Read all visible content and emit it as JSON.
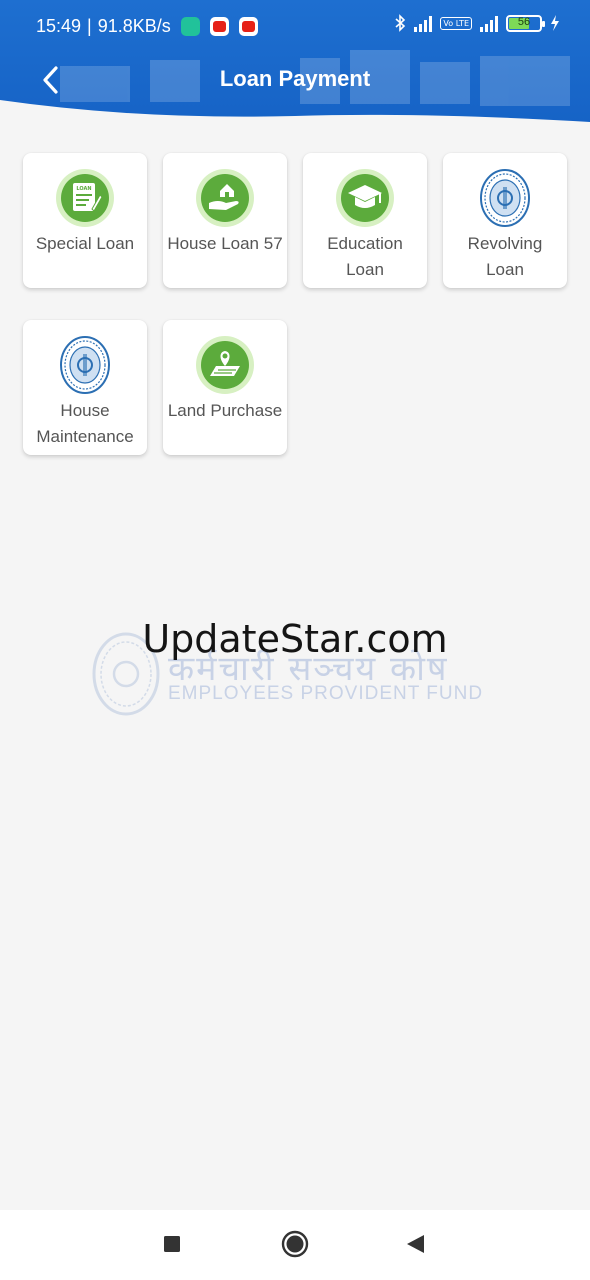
{
  "status_bar": {
    "time": "15:49",
    "separator": "|",
    "speed": "91.8KB/s",
    "battery": "56",
    "volte_label": "Vo LTE"
  },
  "header": {
    "title": "Loan Payment",
    "back_icon": "chevron-left-icon"
  },
  "loan_types": [
    {
      "label": "Special Loan",
      "icon": "loan-document-icon"
    },
    {
      "label": "House Loan 57",
      "icon": "house-hand-icon"
    },
    {
      "label": "Education Loan",
      "icon": "graduation-cap-icon"
    },
    {
      "label": "Revolving Loan",
      "icon": "epf-seal-icon"
    },
    {
      "label": "House Maintenance",
      "icon": "epf-seal-icon"
    },
    {
      "label": "Land Purchase",
      "icon": "land-map-pin-icon"
    }
  ],
  "loan_icon_text": "LOAN",
  "watermark": {
    "title": "UpdateStar.com",
    "nepali": "कर्मचारी सञ्चय कोष",
    "english": "EMPLOYEES PROVIDENT FUND"
  },
  "colors": {
    "header_blue": "#1565c8",
    "icon_green": "#5cab3c",
    "icon_ring": "#d7f0c2",
    "seal_blue": "#2c6fb3"
  },
  "nav_bar": {
    "recents_icon": "square-icon",
    "home_icon": "circle-home-icon",
    "back_icon": "triangle-back-icon"
  }
}
